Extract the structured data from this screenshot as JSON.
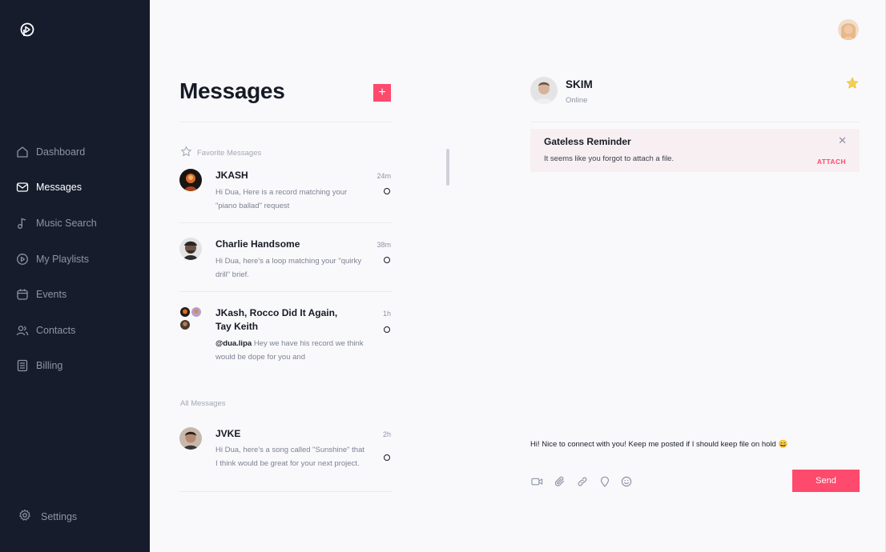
{
  "sidebar": {
    "items": [
      {
        "label": "Dashboard",
        "icon": "home-icon",
        "active": false
      },
      {
        "label": "Messages",
        "icon": "mail-icon",
        "active": true
      },
      {
        "label": "Music Search",
        "icon": "music-note-icon",
        "active": false
      },
      {
        "label": "My Playlists",
        "icon": "play-circle-icon",
        "active": false
      },
      {
        "label": "Events",
        "icon": "calendar-icon",
        "active": false
      },
      {
        "label": "Contacts",
        "icon": "users-icon",
        "active": false
      },
      {
        "label": "Billing",
        "icon": "list-icon",
        "active": false
      }
    ],
    "settings_label": "Settings"
  },
  "messages": {
    "title": "Messages",
    "add_label": "+",
    "favorites_label": "Favorite Messages",
    "all_label": "All Messages",
    "favorites": [
      {
        "name": "JKASH",
        "time": "24m",
        "preview": "Hi Dua, Here is a record matching your \"piano ballad\" request"
      },
      {
        "name": "Charlie Handsome",
        "time": "38m",
        "preview": "Hi Dua, here's a loop matching your \"quirky drill\" brief."
      },
      {
        "name": "JKash, Rocco Did It Again, Tay Keith",
        "time": "1h",
        "mention": "@dua.lipa",
        "preview": "Hey we have his record we think would be dope for you and"
      }
    ],
    "all": [
      {
        "name": "JVKE",
        "time": "2h",
        "preview": "Hi Dua, here's a song called \"Sunshine\" that I think would be great for your next project."
      }
    ]
  },
  "chat": {
    "contact_name": "SKIM",
    "contact_status": "Online",
    "reminder": {
      "title": "Gateless Reminder",
      "body": "It seems like you forgot to attach a file.",
      "close_label": "✕",
      "action_label": "ATTACH"
    },
    "compose_text": "Hi! Nice to connect with you! Keep me posted if I should keep file on hold 😄",
    "send_label": "Send"
  },
  "colors": {
    "sidebar_bg": "#161c2c",
    "accent": "#fe4a6c",
    "star": "#f7cf4a",
    "background": "#f9f9fb"
  }
}
